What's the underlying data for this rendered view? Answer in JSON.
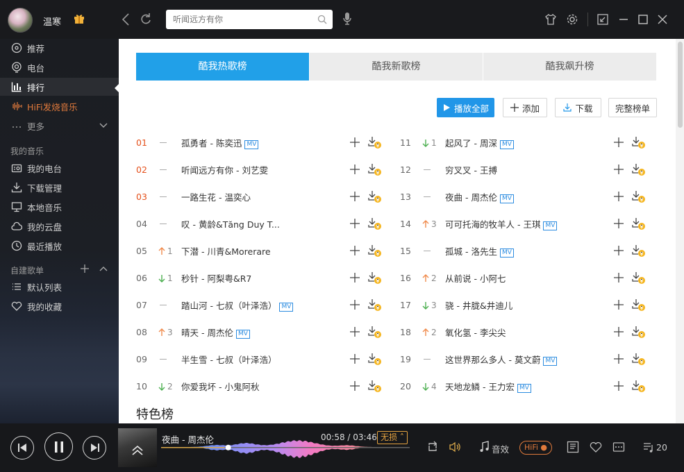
{
  "user": {
    "name": "温寒"
  },
  "search": {
    "placeholder": "听闻远方有你"
  },
  "sidebar": {
    "items": [
      {
        "label": "推荐",
        "icon": "disc-icon"
      },
      {
        "label": "电台",
        "icon": "radio-icon"
      },
      {
        "label": "排行",
        "icon": "chart-icon"
      },
      {
        "label": "HiFi发烧音乐",
        "icon": "soundwave-icon"
      },
      {
        "label": "更多",
        "icon": "dots-icon"
      }
    ],
    "my_music_title": "我的音乐",
    "my_music": [
      {
        "label": "我的电台",
        "icon": "radio-box-icon"
      },
      {
        "label": "下载管理",
        "icon": "download-icon"
      },
      {
        "label": "本地音乐",
        "icon": "monitor-icon"
      },
      {
        "label": "我的云盘",
        "icon": "cloud-icon"
      },
      {
        "label": "最近播放",
        "icon": "clock-icon"
      }
    ],
    "custom_title": "自建歌单",
    "custom": [
      {
        "label": "默认列表",
        "icon": "list-icon"
      },
      {
        "label": "我的收藏",
        "icon": "heart-icon"
      }
    ]
  },
  "tabs": [
    "酷我热歌榜",
    "酷我新歌榜",
    "酷我飙升榜"
  ],
  "actions": {
    "play_all": "播放全部",
    "add": "添加",
    "download": "下载",
    "full_list": "完整榜单"
  },
  "songs_left": [
    {
      "rank": "01",
      "trend": "",
      "change": "",
      "title": "孤勇者 - 陈奕迅",
      "mv": "MV"
    },
    {
      "rank": "02",
      "trend": "",
      "change": "",
      "title": "听闻远方有你 - 刘艺雯",
      "mv": ""
    },
    {
      "rank": "03",
      "trend": "",
      "change": "",
      "title": "一路生花 - 温奕心",
      "mv": ""
    },
    {
      "rank": "04",
      "trend": "",
      "change": "",
      "title": "叹 - 黄龄&Tăng Duy T...",
      "mv": ""
    },
    {
      "rank": "05",
      "trend": "up",
      "change": "1",
      "title": "下潜 - 川青&Morerare",
      "mv": ""
    },
    {
      "rank": "06",
      "trend": "down",
      "change": "1",
      "title": "秒针 - 阿梨粤&R7",
      "mv": ""
    },
    {
      "rank": "07",
      "trend": "",
      "change": "",
      "title": "踏山河 - 七叔（叶泽浩）",
      "mv": "MV"
    },
    {
      "rank": "08",
      "trend": "up",
      "change": "3",
      "title": "晴天 - 周杰伦",
      "mv": "MV"
    },
    {
      "rank": "09",
      "trend": "",
      "change": "",
      "title": "半生雪 - 七叔（叶泽浩）",
      "mv": ""
    },
    {
      "rank": "10",
      "trend": "down",
      "change": "2",
      "title": "你爱我坏 - 小鬼阿秋",
      "mv": ""
    }
  ],
  "songs_right": [
    {
      "rank": "11",
      "trend": "down",
      "change": "1",
      "title": "起风了 - 周深",
      "mv": "MV"
    },
    {
      "rank": "12",
      "trend": "",
      "change": "",
      "title": "穷叉叉 - 王搏",
      "mv": ""
    },
    {
      "rank": "13",
      "trend": "",
      "change": "",
      "title": "夜曲 - 周杰伦",
      "mv": "MV"
    },
    {
      "rank": "14",
      "trend": "up",
      "change": "3",
      "title": "可可托海的牧羊人 - 王琪",
      "mv": "MV"
    },
    {
      "rank": "15",
      "trend": "",
      "change": "",
      "title": "孤城 - 洛先生",
      "mv": "MV"
    },
    {
      "rank": "16",
      "trend": "up",
      "change": "2",
      "title": "从前说 - 小阿七",
      "mv": ""
    },
    {
      "rank": "17",
      "trend": "down",
      "change": "3",
      "title": "骁 - 井胧&井迪儿",
      "mv": ""
    },
    {
      "rank": "18",
      "trend": "up",
      "change": "2",
      "title": "氧化氢 - 李尖尖",
      "mv": ""
    },
    {
      "rank": "19",
      "trend": "",
      "change": "",
      "title": "这世界那么多人 - 莫文蔚",
      "mv": "MV"
    },
    {
      "rank": "20",
      "trend": "down",
      "change": "4",
      "title": "天地龙鳞 - 王力宏",
      "mv": "MV"
    }
  ],
  "section": {
    "title": "特色榜"
  },
  "player": {
    "track": "夜曲 - 周杰伦",
    "time": "00:58 / 03:46",
    "progress": 0.256,
    "quality": "无损",
    "effects": "音效",
    "hifi": "HiFi",
    "queue_count": "20"
  },
  "colors": {
    "accent": "#21a0e8",
    "rank_top": "#e5511c",
    "up": "#f08a4b",
    "down": "#4caf50",
    "hifi": "#e07a3c"
  }
}
